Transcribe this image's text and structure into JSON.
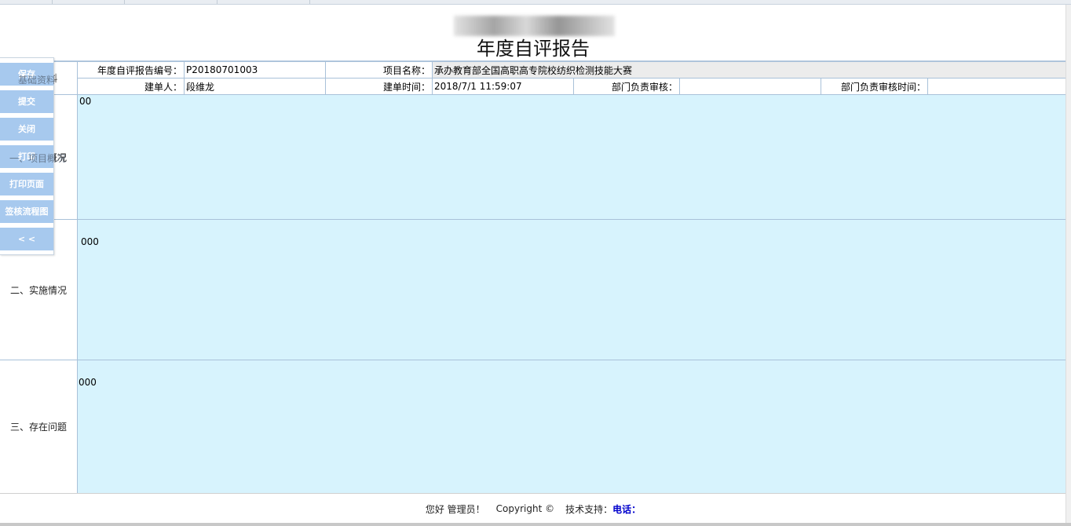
{
  "header": {
    "title": "年度自评报告"
  },
  "form": {
    "basic_label": "基础资料",
    "report_no_label": "年度自评报告编号：",
    "report_no": "P20180701003",
    "project_name_label": "项目名称：",
    "project_name": "承办教育部全国高职高专院校纺织检测技能大赛",
    "creator_label": "建单人：",
    "creator": "段维龙",
    "created_time_label": "建单时间：",
    "created_time": "2018/7/1 11:59:07",
    "dept_review_label": "部门负责审核：",
    "dept_review": "",
    "dept_review_time_label": "部门负责审核时间：",
    "dept_review_time": ""
  },
  "sections": [
    {
      "label": "一、项目概况",
      "content": "00"
    },
    {
      "label": "二、实施情况",
      "content": "000"
    },
    {
      "label": "三、存在问题",
      "content": "000"
    }
  ],
  "toolbar": {
    "save": "保存",
    "submit": "提交",
    "close": "关闭",
    "print": "打印",
    "print_page": "打印页面",
    "flowchart": "签核流程图",
    "collapse": "< <"
  },
  "footer": {
    "greeting": "您好 管理员！",
    "copyright": "Copyright ©",
    "support_label": "技术支持：",
    "phone_label": "电话："
  }
}
